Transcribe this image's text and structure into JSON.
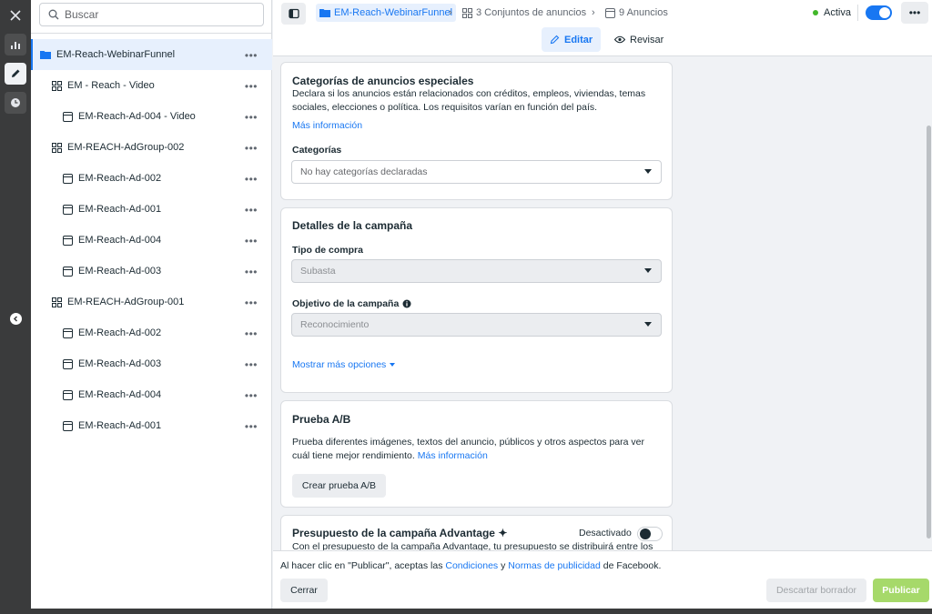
{
  "rail": {
    "items": [
      {
        "icon": "close-icon"
      },
      {
        "icon": "bar-chart-icon"
      },
      {
        "icon": "pencil-icon"
      },
      {
        "icon": "clock-icon"
      },
      {
        "icon": "chevron-left-icon"
      }
    ]
  },
  "tree": {
    "search_placeholder": "Buscar",
    "items": [
      {
        "label": "EM-Reach-WebinarFunnel",
        "type": "campaign",
        "selected": true
      },
      {
        "label": "EM - Reach - Video",
        "type": "adset"
      },
      {
        "label": "EM-Reach-Ad-004 - Video",
        "type": "ad"
      },
      {
        "label": "EM-REACH-AdGroup-002",
        "type": "adset"
      },
      {
        "label": "EM-Reach-Ad-002",
        "type": "ad"
      },
      {
        "label": "EM-Reach-Ad-001",
        "type": "ad"
      },
      {
        "label": "EM-Reach-Ad-004",
        "type": "ad"
      },
      {
        "label": "EM-Reach-Ad-003",
        "type": "ad"
      },
      {
        "label": "EM-REACH-AdGroup-001",
        "type": "adset"
      },
      {
        "label": "EM-Reach-Ad-002",
        "type": "ad"
      },
      {
        "label": "EM-Reach-Ad-003",
        "type": "ad"
      },
      {
        "label": "EM-Reach-Ad-004",
        "type": "ad"
      },
      {
        "label": "EM-Reach-Ad-001",
        "type": "ad"
      }
    ],
    "more": "•••"
  },
  "topbar": {
    "breadcrumbs": {
      "campaign": "EM-Reach-WebinarFunnel",
      "adsets": "3 Conjuntos de anuncios",
      "ads": "9 Anuncios"
    },
    "status": "Activa",
    "more": "•••",
    "edit_label": "Editar",
    "review_label": "Revisar"
  },
  "special_categories": {
    "title": "Categorías de anuncios especiales",
    "description": "Declara si los anuncios están relacionados con créditos, empleos, viviendas, temas sociales, elecciones o política. Los requisitos varían en función del país.",
    "link": "Más información",
    "categories_label": "Categorías",
    "categories_value": "No hay categorías declaradas"
  },
  "campaign_details": {
    "title": "Detalles de la campaña",
    "buy_type_label": "Tipo de compra",
    "buy_type_value": "Subasta",
    "objective_label": "Objetivo de la campaña",
    "objective_value": "Reconocimiento",
    "more_options": "Mostrar más opciones"
  },
  "ab_test": {
    "title": "Prueba A/B",
    "description": "Prueba diferentes imágenes, textos del anuncio, públicos y otros aspectos para ver cuál tiene mejor rendimiento.",
    "link": "Más información",
    "button": "Crear prueba A/B"
  },
  "advantage_budget": {
    "title": "Presupuesto de la campaña Advantage",
    "title_symbol": "✦",
    "status": "Desactivado",
    "description": "Con el presupuesto de la campaña Advantage, tu presupuesto se distribuirá entre los"
  },
  "footer": {
    "terms_prefix": "Al hacer clic en \"Publicar\", aceptas las ",
    "terms_link1": "Condiciones",
    "terms_and": " y ",
    "terms_link2": "Normas de publicidad",
    "terms_suffix": " de Facebook.",
    "close": "Cerrar",
    "discard": "Descartar borrador",
    "publish": "Publicar"
  },
  "colors": {
    "accent": "#1877f2",
    "active_status": "#42b72a",
    "publish_button": "#a6d96a"
  }
}
